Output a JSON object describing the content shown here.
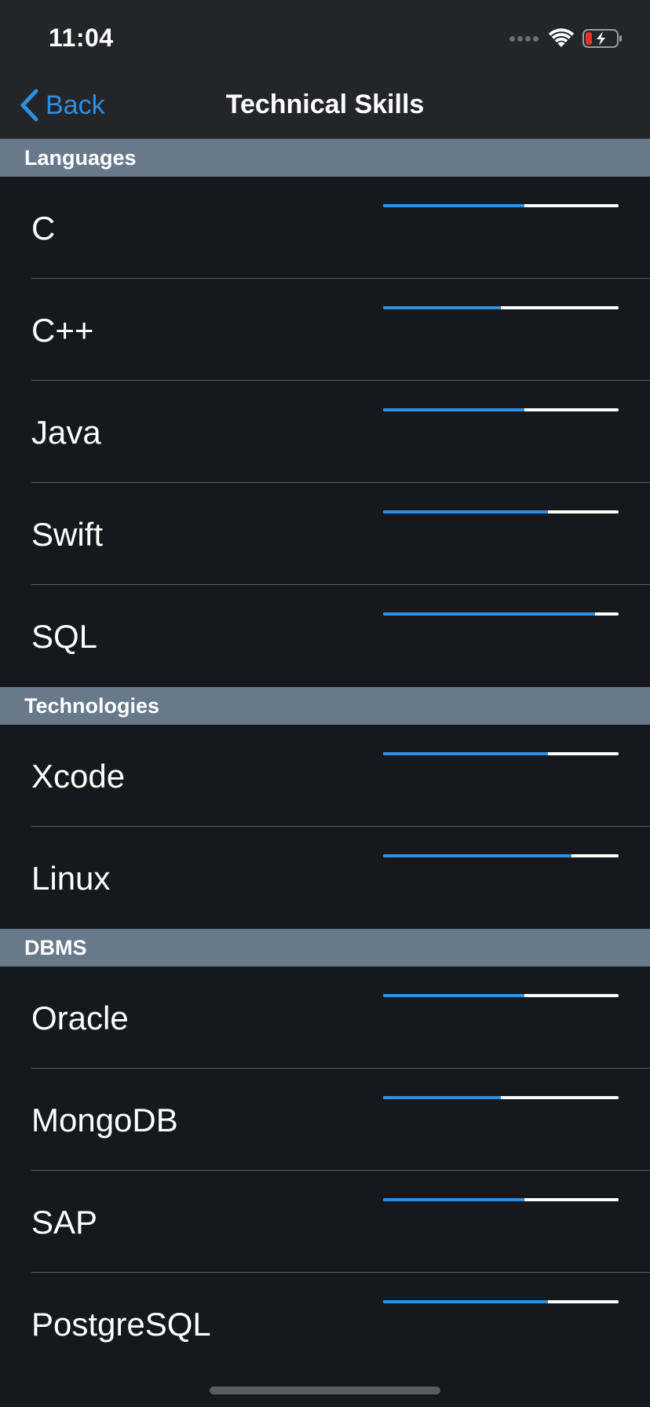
{
  "status_bar": {
    "time": "11:04",
    "icons": [
      "signal-icon",
      "wifi-icon",
      "battery-charging-icon"
    ]
  },
  "nav": {
    "back_label": "Back",
    "title": "Technical Skills"
  },
  "colors": {
    "accent": "#2e8fe0",
    "section_header": "#67798a",
    "background": "#16181d",
    "battery_low": "#e5322d"
  },
  "sections": [
    {
      "title": "Languages",
      "items": [
        {
          "label": "C",
          "level": 0.6
        },
        {
          "label": "C++",
          "level": 0.5
        },
        {
          "label": "Java",
          "level": 0.6
        },
        {
          "label": "Swift",
          "level": 0.7
        },
        {
          "label": "SQL",
          "level": 0.9
        }
      ]
    },
    {
      "title": "Technologies",
      "items": [
        {
          "label": "Xcode",
          "level": 0.7
        },
        {
          "label": "Linux",
          "level": 0.8
        }
      ]
    },
    {
      "title": "DBMS",
      "items": [
        {
          "label": "Oracle",
          "level": 0.6
        },
        {
          "label": "MongoDB",
          "level": 0.5
        },
        {
          "label": "SAP",
          "level": 0.6
        },
        {
          "label": "PostgreSQL",
          "level": 0.7
        }
      ]
    }
  ]
}
